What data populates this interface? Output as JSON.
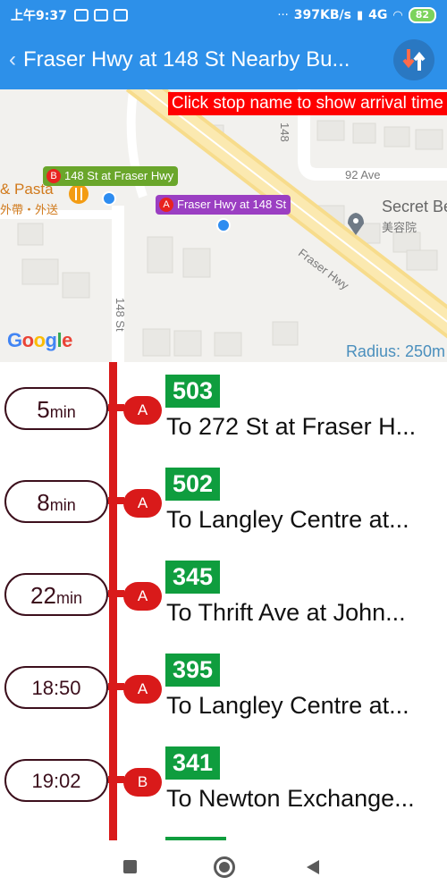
{
  "status_bar": {
    "time": "上午9:37",
    "network_speed": "397KB/s",
    "network_type": "4G",
    "battery": "82",
    "dots": "···"
  },
  "app_bar": {
    "back_glyph": "‹",
    "title": "Fraser Hwy at 148 St   Nearby Bu...",
    "sort_icon": "sort-arrows-icon"
  },
  "map": {
    "banner": "Click stop name to show arrival time",
    "stops": [
      {
        "letter": "B",
        "name": "148 St at Fraser Hwy",
        "color": "#6aa62b"
      },
      {
        "letter": "A",
        "name": "Fraser Hwy at 148 St",
        "color": "#9b3fc2"
      }
    ],
    "street_labels": {
      "st148_top": "148",
      "ave92": "92 Ave",
      "fraser_hwy": "Fraser Hwy",
      "st148_bottom": "148 St"
    },
    "poi_left": {
      "name": "& Pasta",
      "sub": "外帶・外送"
    },
    "poi_right": {
      "name": "Secret Be",
      "sub": "美容院"
    },
    "google_logo": "Google",
    "radius": "Radius: 250m"
  },
  "arrivals": [
    {
      "time_value": "5",
      "time_unit": "min",
      "stop": "A",
      "route": "503",
      "destination": "To 272 St at Fraser H..."
    },
    {
      "time_value": "8",
      "time_unit": "min",
      "stop": "A",
      "route": "502",
      "destination": "To Langley Centre at..."
    },
    {
      "time_value": "22",
      "time_unit": "min",
      "stop": "A",
      "route": "345",
      "destination": "To Thrift Ave at John..."
    },
    {
      "time_value": "18:50",
      "time_unit": "",
      "stop": "A",
      "route": "395",
      "destination": "To Langley Centre at..."
    },
    {
      "time_value": "19:02",
      "time_unit": "",
      "stop": "B",
      "route": "341",
      "destination": "To Newton Exchange..."
    }
  ],
  "colors": {
    "primary": "#2d90e9",
    "timeline": "#d91a1a",
    "route_badge": "#0f9d3e",
    "banner": "#ff0000"
  }
}
